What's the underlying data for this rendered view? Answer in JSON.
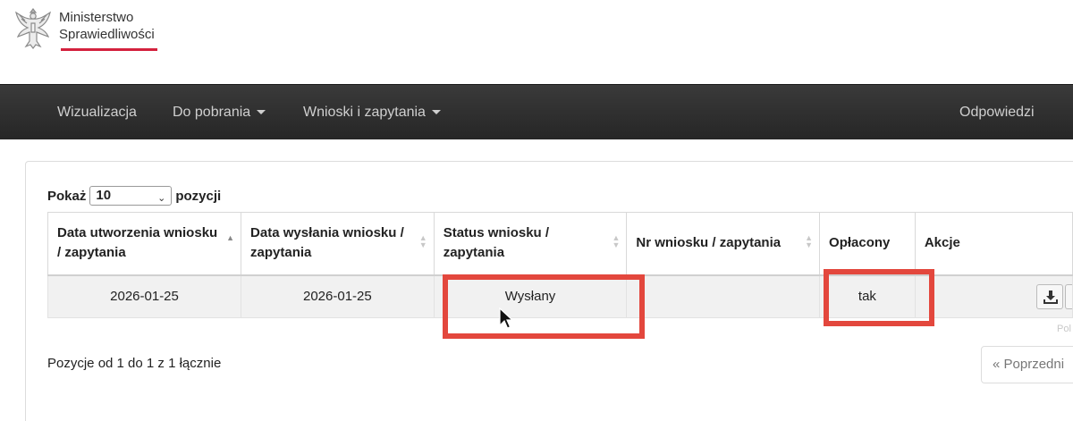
{
  "header": {
    "logo_line1": "Ministerstwo",
    "logo_line2": "Sprawiedliwości",
    "brand_red": "#d4213d"
  },
  "navbar": {
    "items": [
      {
        "label": "Wizualizacja",
        "dropdown": false
      },
      {
        "label": "Do pobrania",
        "dropdown": true
      },
      {
        "label": "Wnioski i zapytania",
        "dropdown": true
      },
      {
        "label": "Odpowiedzi",
        "dropdown": false
      }
    ]
  },
  "length_menu": {
    "prefix": "Pokaż",
    "selected": "10",
    "suffix": "pozycji"
  },
  "table": {
    "columns": [
      {
        "label": "Data utworzenia wniosku / zapytania",
        "sortable": true,
        "sorted": "asc"
      },
      {
        "label": "Data wysłania wniosku / zapytania",
        "sortable": true
      },
      {
        "label": "Status wniosku / zapytania",
        "sortable": true
      },
      {
        "label": "Nr wniosku / zapytania",
        "sortable": true
      },
      {
        "label": "Opłacony",
        "sortable": false
      },
      {
        "label": "Akcje",
        "sortable": false
      }
    ],
    "rows": [
      {
        "created": "2026-01-25",
        "sent": "2026-01-25",
        "status": "Wysłany",
        "number": "",
        "paid": "tak",
        "actions_icon": "download-icon"
      }
    ]
  },
  "info_text": "Pozycje od 1 do 1 z 1 łącznie",
  "pagination": {
    "prev_label": "« Poprzedni"
  },
  "faint_text": "Pol",
  "highlight_color": "#e3473d"
}
